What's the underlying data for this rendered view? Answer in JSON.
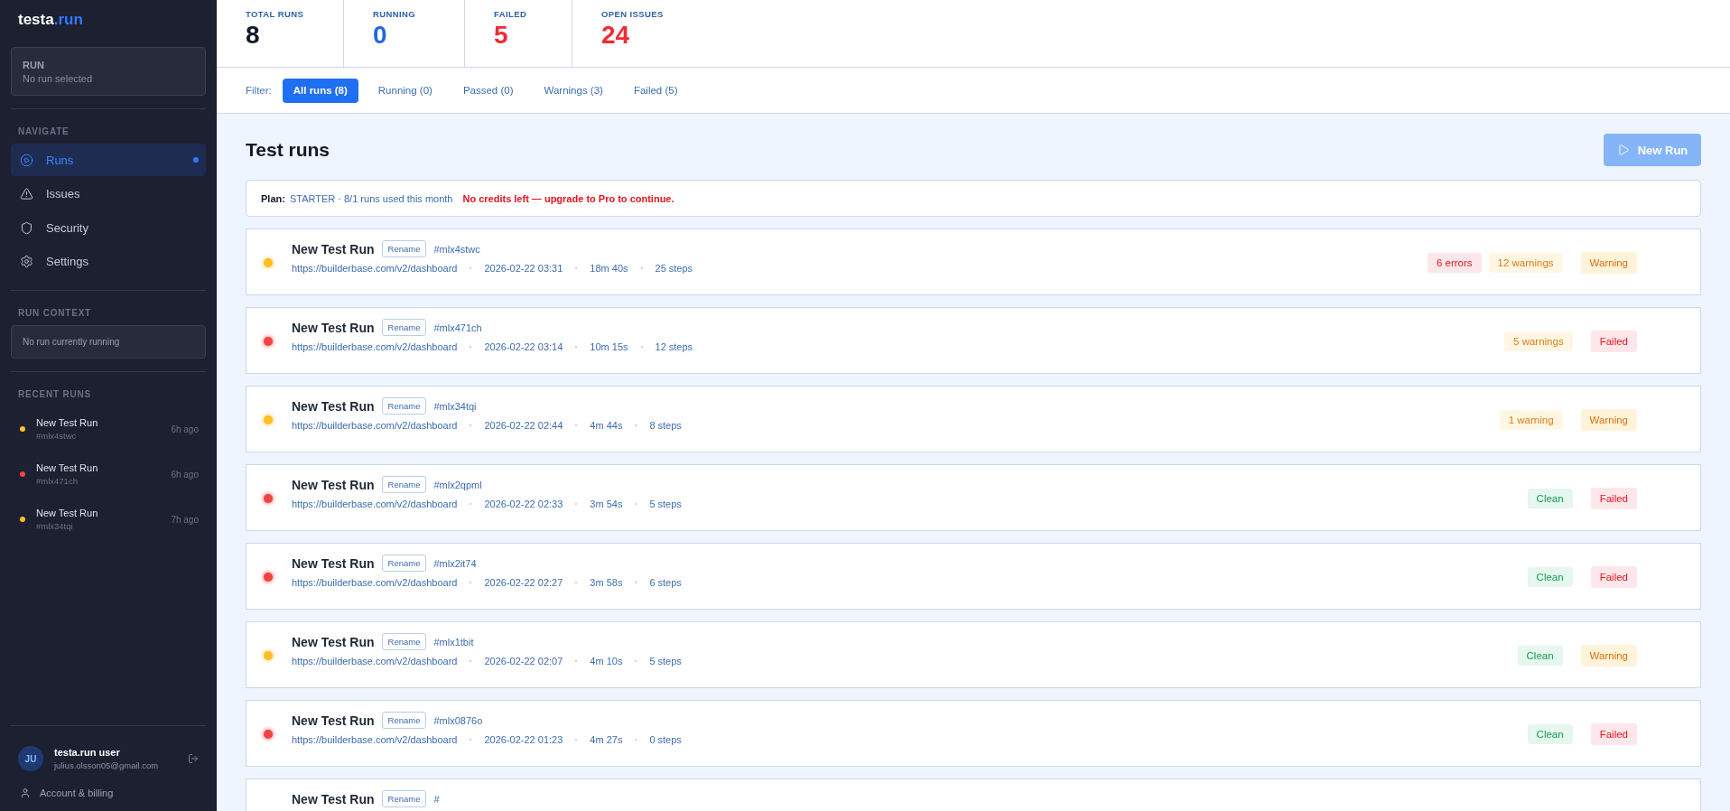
{
  "sidebar": {
    "logo": {
      "main": "testa",
      "accent": ".run"
    },
    "run_box": {
      "label": "RUN",
      "value": "No run selected"
    },
    "navigate": {
      "heading": "NAVIGATE",
      "items": [
        {
          "label": "Runs",
          "kind": "runs",
          "selected": true
        },
        {
          "label": "Issues",
          "kind": "issues",
          "selected": false
        },
        {
          "label": "Security",
          "kind": "security",
          "selected": false
        },
        {
          "label": "Settings",
          "kind": "settings",
          "selected": false
        }
      ]
    },
    "run_context": {
      "heading": "RUN CONTEXT",
      "text": "No run currently running"
    },
    "recent_runs": {
      "heading": "RECENT RUNS",
      "items": [
        {
          "name": "New Test Run",
          "id": "#mlx4stwc",
          "time": "6h ago",
          "color": "#fbbf24"
        },
        {
          "name": "New Test Run",
          "id": "#mlx471ch",
          "time": "6h ago",
          "color": "#ef4444"
        },
        {
          "name": "New Test Run",
          "id": "#mlx34tqi",
          "time": "7h ago",
          "color": "#fbbf24"
        }
      ]
    },
    "user": {
      "initials": "JU",
      "name": "testa.run user",
      "email": "julius.olsson05@gmail.com"
    },
    "account_link": "Account & billing"
  },
  "stats": [
    {
      "label": "TOTAL RUNS",
      "value": "8",
      "color": "#111827"
    },
    {
      "label": "RUNNING",
      "value": "0",
      "color": "#2563eb"
    },
    {
      "label": "FAILED",
      "value": "5",
      "color": "#ef2b36"
    },
    {
      "label": "OPEN ISSUES",
      "value": "24",
      "color": "#ef2b36"
    }
  ],
  "filter": {
    "label": "Filter:",
    "tabs": [
      {
        "label": "All runs (8)",
        "selected": true
      },
      {
        "label": "Running (0)",
        "selected": false
      },
      {
        "label": "Passed (0)",
        "selected": false
      },
      {
        "label": "Warnings (3)",
        "selected": false
      },
      {
        "label": "Failed (5)",
        "selected": false
      }
    ]
  },
  "title": "Test runs",
  "new_run_button": {
    "label": "New Run",
    "disabled": true
  },
  "plan": {
    "label": "Plan:",
    "text": "STARTER · 8/1 runs used this month",
    "alert": "No credits left — upgrade to Pro to continue."
  },
  "runs": [
    {
      "name": "New Test Run",
      "rename": "Rename",
      "id": "#mlx4stwc",
      "url": "https://builderbase.com/v2/dashboard",
      "date": "2026-02-22 03:31",
      "duration": "18m 40s",
      "steps": "25 steps",
      "color": "#fbbf24",
      "badges": [
        {
          "kind": "errors",
          "text": "6 errors"
        },
        {
          "kind": "warnings",
          "text": "12 warnings"
        }
      ],
      "status": {
        "kind": "warning",
        "text": "Warning"
      }
    },
    {
      "name": "New Test Run",
      "rename": "Rename",
      "id": "#mlx471ch",
      "url": "https://builderbase.com/v2/dashboard",
      "date": "2026-02-22 03:14",
      "duration": "10m 15s",
      "steps": "12 steps",
      "color": "#ef4444",
      "badges": [
        {
          "kind": "warnings",
          "text": "5 warnings"
        }
      ],
      "status": {
        "kind": "failed",
        "text": "Failed"
      }
    },
    {
      "name": "New Test Run",
      "rename": "Rename",
      "id": "#mlx34tqi",
      "url": "https://builderbase.com/v2/dashboard",
      "date": "2026-02-22 02:44",
      "duration": "4m 44s",
      "steps": "8 steps",
      "color": "#fbbf24",
      "badges": [
        {
          "kind": "warnings",
          "text": "1 warning"
        }
      ],
      "status": {
        "kind": "warning",
        "text": "Warning"
      }
    },
    {
      "name": "New Test Run",
      "rename": "Rename",
      "id": "#mlx2qpml",
      "url": "https://builderbase.com/v2/dashboard",
      "date": "2026-02-22 02:33",
      "duration": "3m 54s",
      "steps": "5 steps",
      "color": "#ef4444",
      "badges": [
        {
          "kind": "clean",
          "text": "Clean"
        }
      ],
      "status": {
        "kind": "failed",
        "text": "Failed"
      }
    },
    {
      "name": "New Test Run",
      "rename": "Rename",
      "id": "#mlx2it74",
      "url": "https://builderbase.com/v2/dashboard",
      "date": "2026-02-22 02:27",
      "duration": "3m 58s",
      "steps": "6 steps",
      "color": "#ef4444",
      "badges": [
        {
          "kind": "clean",
          "text": "Clean"
        }
      ],
      "status": {
        "kind": "failed",
        "text": "Failed"
      }
    },
    {
      "name": "New Test Run",
      "rename": "Rename",
      "id": "#mlx1tbit",
      "url": "https://builderbase.com/v2/dashboard",
      "date": "2026-02-22 02:07",
      "duration": "4m 10s",
      "steps": "5 steps",
      "color": "#fbbf24",
      "badges": [
        {
          "kind": "clean",
          "text": "Clean"
        }
      ],
      "status": {
        "kind": "warning",
        "text": "Warning"
      }
    },
    {
      "name": "New Test Run",
      "rename": "Rename",
      "id": "#mlx0876o",
      "url": "https://builderbase.com/v2/dashboard",
      "date": "2026-02-22 01:23",
      "duration": "4m 27s",
      "steps": "0 steps",
      "color": "#ef4444",
      "badges": [
        {
          "kind": "clean",
          "text": "Clean"
        }
      ],
      "status": {
        "kind": "failed",
        "text": "Failed"
      }
    },
    {
      "name": "New Test Run",
      "rename": "Rename",
      "id": "#"
    }
  ]
}
